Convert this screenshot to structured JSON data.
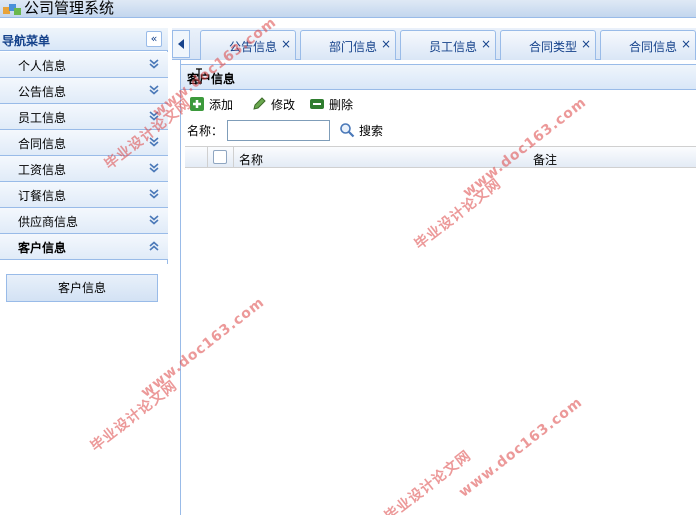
{
  "app": {
    "title": "公司管理系统"
  },
  "nav": {
    "header": "导航菜单",
    "collapse_symbol": "«",
    "items": [
      {
        "label": "个人信息",
        "expanded": false
      },
      {
        "label": "公告信息",
        "expanded": false
      },
      {
        "label": "员工信息",
        "expanded": false
      },
      {
        "label": "合同信息",
        "expanded": false
      },
      {
        "label": "工资信息",
        "expanded": false
      },
      {
        "label": "订餐信息",
        "expanded": false
      },
      {
        "label": "供应商信息",
        "expanded": false
      },
      {
        "label": "客户信息",
        "expanded": true
      }
    ],
    "sub_items": [
      {
        "label": "客户信息"
      }
    ]
  },
  "tabs": [
    {
      "label": "公告信息",
      "close": "×"
    },
    {
      "label": "部门信息",
      "close": "×"
    },
    {
      "label": "员工信息",
      "close": "×"
    },
    {
      "label": "合同类型",
      "close": "×"
    },
    {
      "label": "合同信息",
      "close": "×"
    }
  ],
  "panel": {
    "title": "客户信息"
  },
  "toolbar": {
    "add_label": "添加",
    "edit_label": "修改",
    "delete_label": "删除"
  },
  "search": {
    "label": "名称：",
    "value": "",
    "placeholder": "",
    "button_label": "搜索"
  },
  "grid": {
    "columns": [
      "名称",
      "备注"
    ],
    "rows": []
  },
  "watermarks": {
    "line1": "毕业设计论文网",
    "line2": "www.doc163.com"
  },
  "colors": {
    "border": "#99bbe8",
    "header_text": "#15428b",
    "watermark": "#dc4646"
  }
}
